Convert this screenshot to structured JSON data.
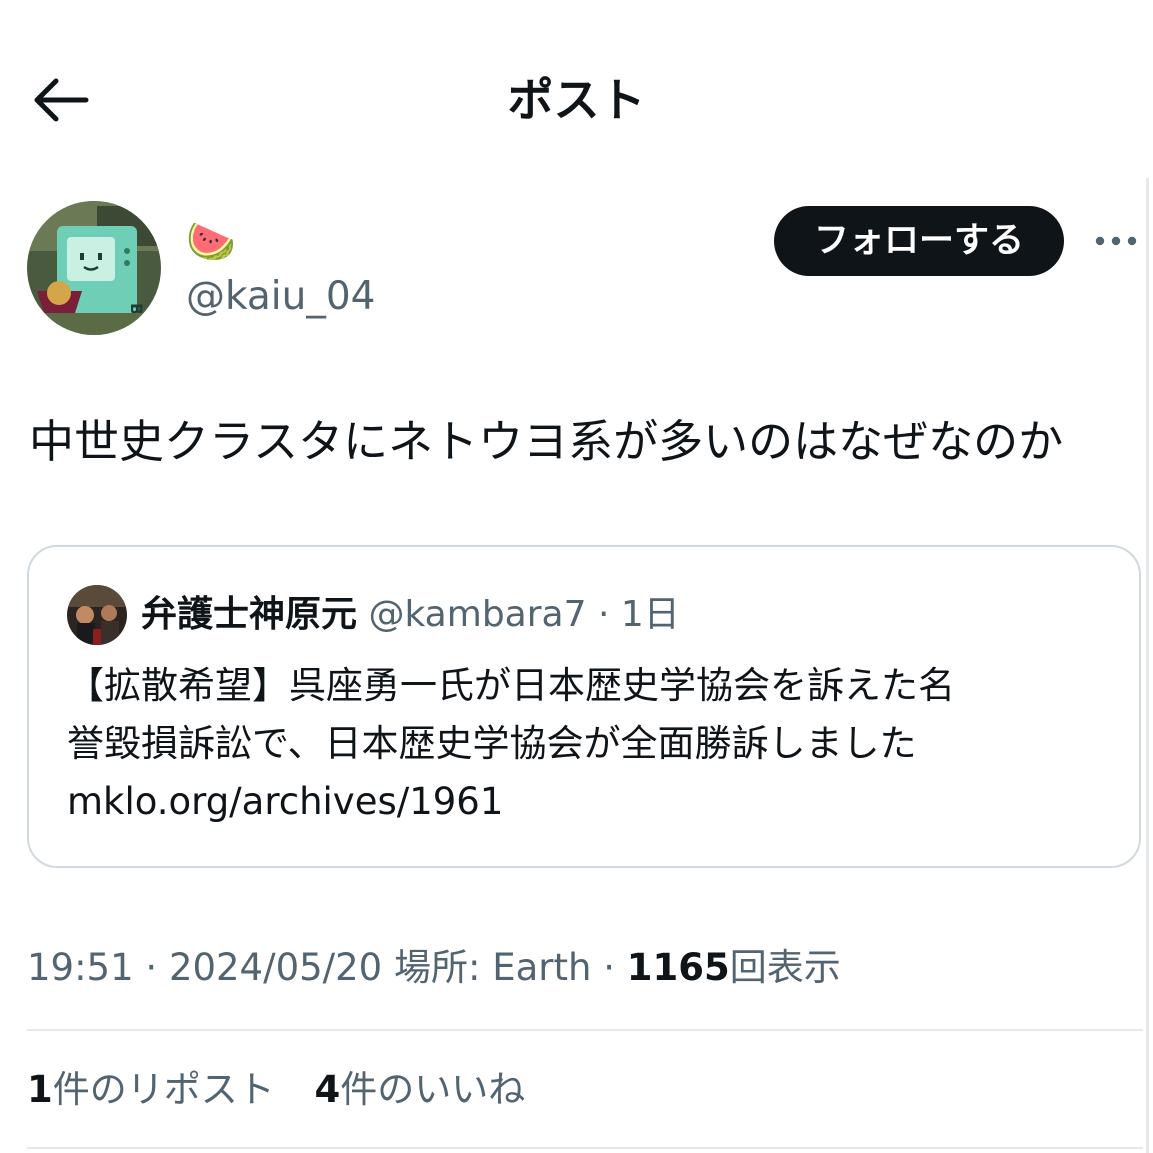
{
  "header": {
    "title": "ポスト"
  },
  "author": {
    "display_name": "🍉",
    "handle": "@kaiu_04",
    "follow_label": "フォローする"
  },
  "post": {
    "text": "中世史クラスタにネトウヨ系が多いのはなぜなのか"
  },
  "quote": {
    "name": "弁護士神原元",
    "handle": "@kambara7",
    "separator": "·",
    "age": "1日",
    "lines": [
      "【拡散希望】呉座勇一氏が日本歴史学協会を訴えた名",
      "誉毀損訴訟で、日本歴史学協会が全面勝訴しました",
      "mklo.org/archives/1961"
    ]
  },
  "meta": {
    "time": "19:51",
    "sep": "·",
    "date": "2024/05/20",
    "location": "場所: Earth",
    "views_count": "1165",
    "views_label": "回表示"
  },
  "stats": {
    "reposts_count": "1",
    "reposts_label": "件のリポスト",
    "likes_count": "4",
    "likes_label": "件のいいね"
  },
  "colors": {
    "text_primary": "#0f1419",
    "text_secondary": "#536471",
    "border": "#cfd9de",
    "divider": "#e6e9eb",
    "follow_bg": "#0f1419"
  }
}
